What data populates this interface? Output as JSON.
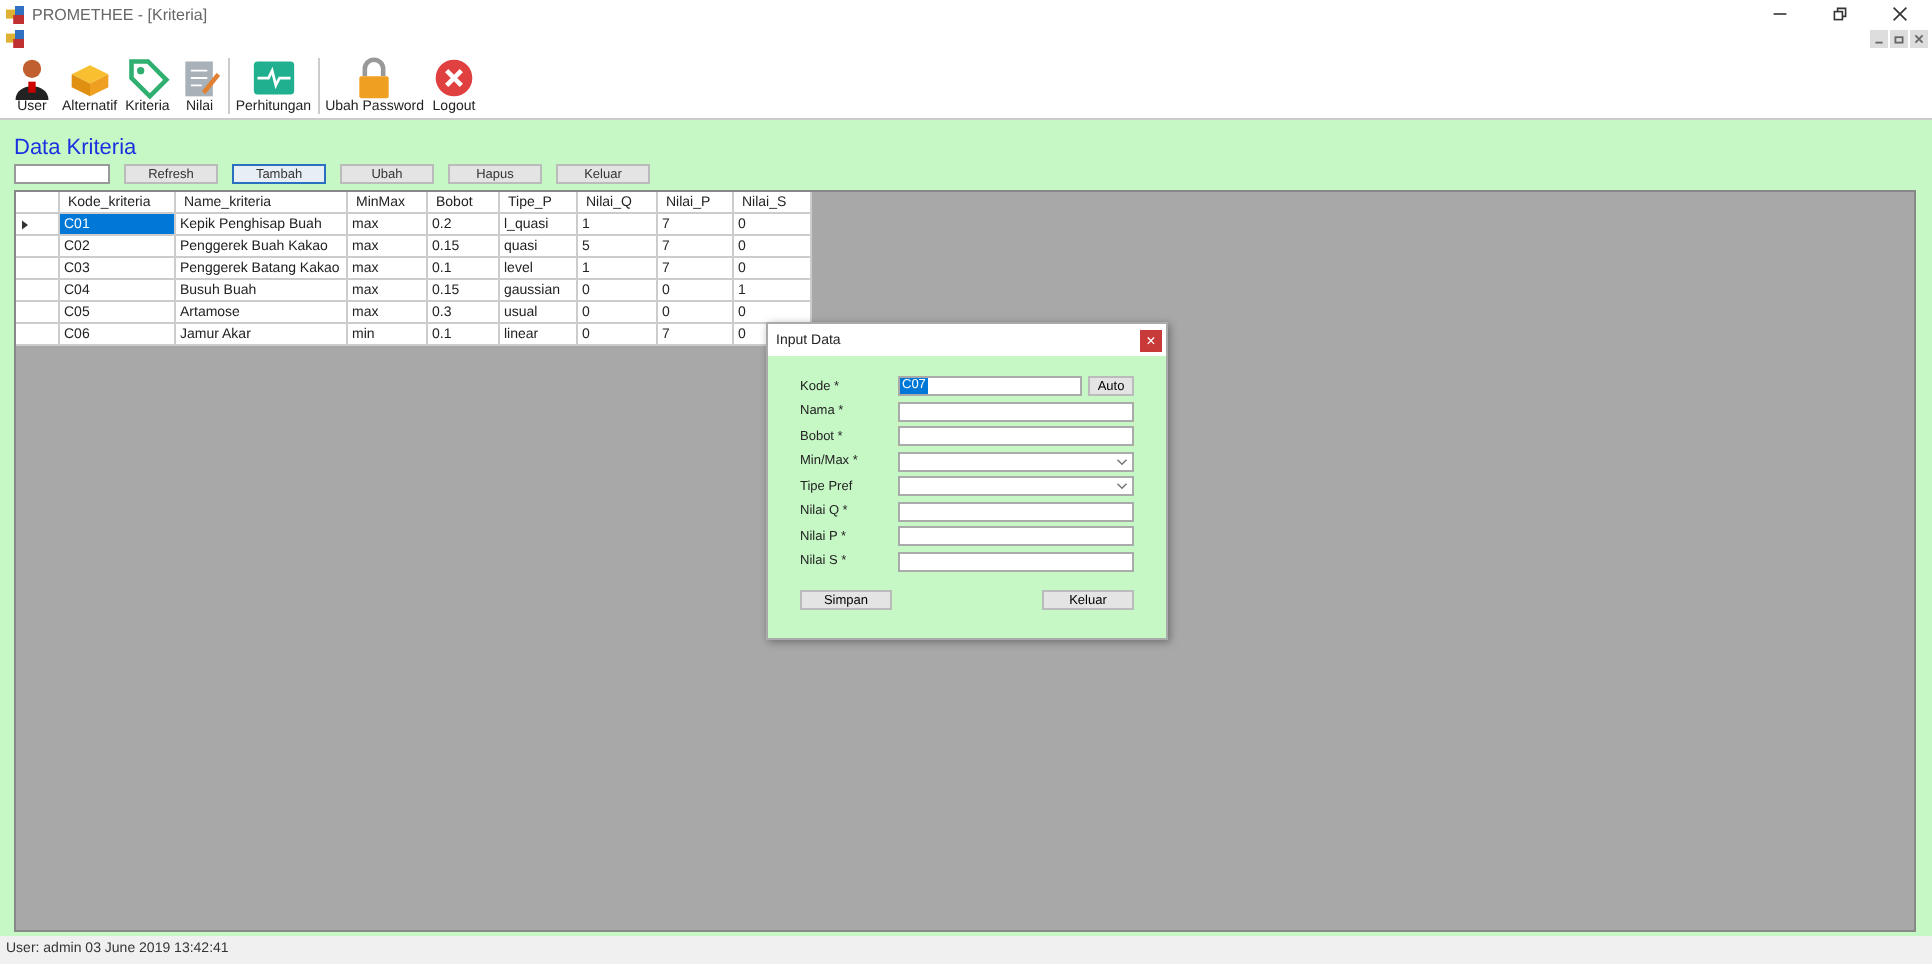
{
  "window": {
    "title": "PROMETHEE - [Kriteria]"
  },
  "toolbar": [
    {
      "label": "User",
      "kind": "user"
    },
    {
      "label": "Alternatif",
      "kind": "box"
    },
    {
      "label": "Kriteria",
      "kind": "tag"
    },
    {
      "label": "Nilai",
      "kind": "notepad"
    },
    {
      "label": "Perhitungan",
      "kind": "pulse"
    },
    {
      "label": "Ubah Password",
      "kind": "lock"
    },
    {
      "label": "Logout",
      "kind": "close"
    }
  ],
  "heading": "Data Kriteria",
  "actions": [
    {
      "label": "Refresh",
      "selected": false
    },
    {
      "label": "Tambah",
      "selected": true
    },
    {
      "label": "Ubah",
      "selected": false
    },
    {
      "label": "Hapus",
      "selected": false
    },
    {
      "label": "Keluar",
      "selected": false
    }
  ],
  "table": {
    "columns": [
      "Kode_kriteria",
      "Name_kriteria",
      "MinMax",
      "Bobot",
      "Tipe_P",
      "Nilai_Q",
      "Nilai_P",
      "Nilai_S"
    ],
    "rows": [
      {
        "cells": [
          "C01",
          "Kepik Penghisap Buah",
          "max",
          "0.2",
          "l_quasi",
          "1",
          "7",
          "0"
        ],
        "selected": true
      },
      {
        "cells": [
          "C02",
          "Penggerek Buah Kakao",
          "max",
          "0.15",
          "quasi",
          "5",
          "7",
          "0"
        ],
        "selected": false
      },
      {
        "cells": [
          "C03",
          "Penggerek Batang Kakao",
          "max",
          "0.1",
          "level",
          "1",
          "7",
          "0"
        ],
        "selected": false
      },
      {
        "cells": [
          "C04",
          "Busuh Buah",
          "max",
          "0.15",
          "gaussian",
          "0",
          "0",
          "1"
        ],
        "selected": false
      },
      {
        "cells": [
          "C05",
          "Artamose",
          "max",
          "0.3",
          "usual",
          "0",
          "0",
          "0"
        ],
        "selected": false
      },
      {
        "cells": [
          "C06",
          "Jamur Akar",
          "min",
          "0.1",
          "linear",
          "0",
          "7",
          "0"
        ],
        "selected": false
      }
    ]
  },
  "dialog": {
    "title": "Input Data",
    "close": "×",
    "fields": [
      {
        "label": "Kode *",
        "kind": "text",
        "value": "C07",
        "button": "Auto"
      },
      {
        "label": "Nama *",
        "kind": "text"
      },
      {
        "label": "Bobot *",
        "kind": "text"
      },
      {
        "label": "Min/Max *",
        "kind": "select"
      },
      {
        "label": "Tipe Pref",
        "kind": "select"
      },
      {
        "label": "Nilai Q *",
        "kind": "text"
      },
      {
        "label": "Nilai P *",
        "kind": "text"
      },
      {
        "label": "Nilai S *",
        "kind": "text"
      }
    ],
    "buttons": [
      "Simpan",
      "Keluar"
    ]
  },
  "status_bar": "User: admin  03 June 2019 13:42:41"
}
